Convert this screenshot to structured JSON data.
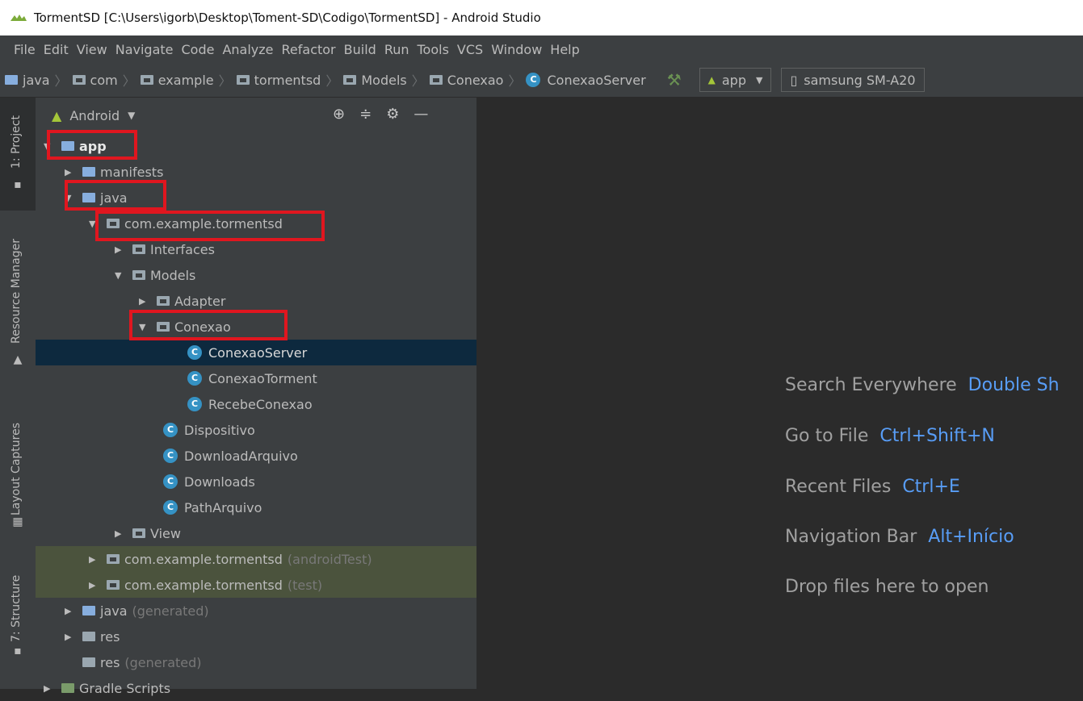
{
  "window": {
    "title": "TormentSD [C:\\Users\\igorb\\Desktop\\Toment-SD\\Codigo\\TormentSD] - Android Studio"
  },
  "menu": [
    "File",
    "Edit",
    "View",
    "Navigate",
    "Code",
    "Analyze",
    "Refactor",
    "Build",
    "Run",
    "Tools",
    "VCS",
    "Window",
    "Help"
  ],
  "breadcrumb": [
    "java",
    "com",
    "example",
    "tormentsd",
    "Models",
    "Conexao",
    "ConexaoServer"
  ],
  "toolbar": {
    "run_config": "app",
    "device": "samsung SM-A20"
  },
  "side_tabs": {
    "project": "1: Project",
    "resource_manager": "Resource Manager",
    "layout_captures": "Layout Captures",
    "structure": "7: Structure"
  },
  "project_panel": {
    "view_mode": "Android",
    "tree": [
      {
        "label": "app"
      },
      {
        "label": "manifests"
      },
      {
        "label": "java"
      },
      {
        "label": "com.example.tormentsd"
      },
      {
        "label": "Interfaces"
      },
      {
        "label": "Models"
      },
      {
        "label": "Adapter"
      },
      {
        "label": "Conexao"
      },
      {
        "label": "ConexaoServer"
      },
      {
        "label": "ConexaoTorment"
      },
      {
        "label": "RecebeConexao"
      },
      {
        "label": "Dispositivo"
      },
      {
        "label": "DownloadArquivo"
      },
      {
        "label": "Downloads"
      },
      {
        "label": "PathArquivo"
      },
      {
        "label": "View"
      },
      {
        "label": "com.example.tormentsd",
        "suffix": "(androidTest)"
      },
      {
        "label": "com.example.tormentsd",
        "suffix": "(test)"
      },
      {
        "label": "java",
        "suffix": "(generated)"
      },
      {
        "label": "res"
      },
      {
        "label": "res",
        "suffix": "(generated)"
      },
      {
        "label": "Gradle Scripts"
      }
    ]
  },
  "editor_hints": [
    {
      "text": "Search Everywhere",
      "key": "Double Sh"
    },
    {
      "text": "Go to File",
      "key": "Ctrl+Shift+N"
    },
    {
      "text": "Recent Files",
      "key": "Ctrl+E"
    },
    {
      "text": "Navigation Bar",
      "key": "Alt+Início"
    },
    {
      "text": "Drop files here to open",
      "key": ""
    }
  ],
  "colors": {
    "highlight_box": "#e0161f",
    "selection": "#0d293e",
    "class_icon": "#3592c4",
    "shortcut": "#589df6"
  }
}
